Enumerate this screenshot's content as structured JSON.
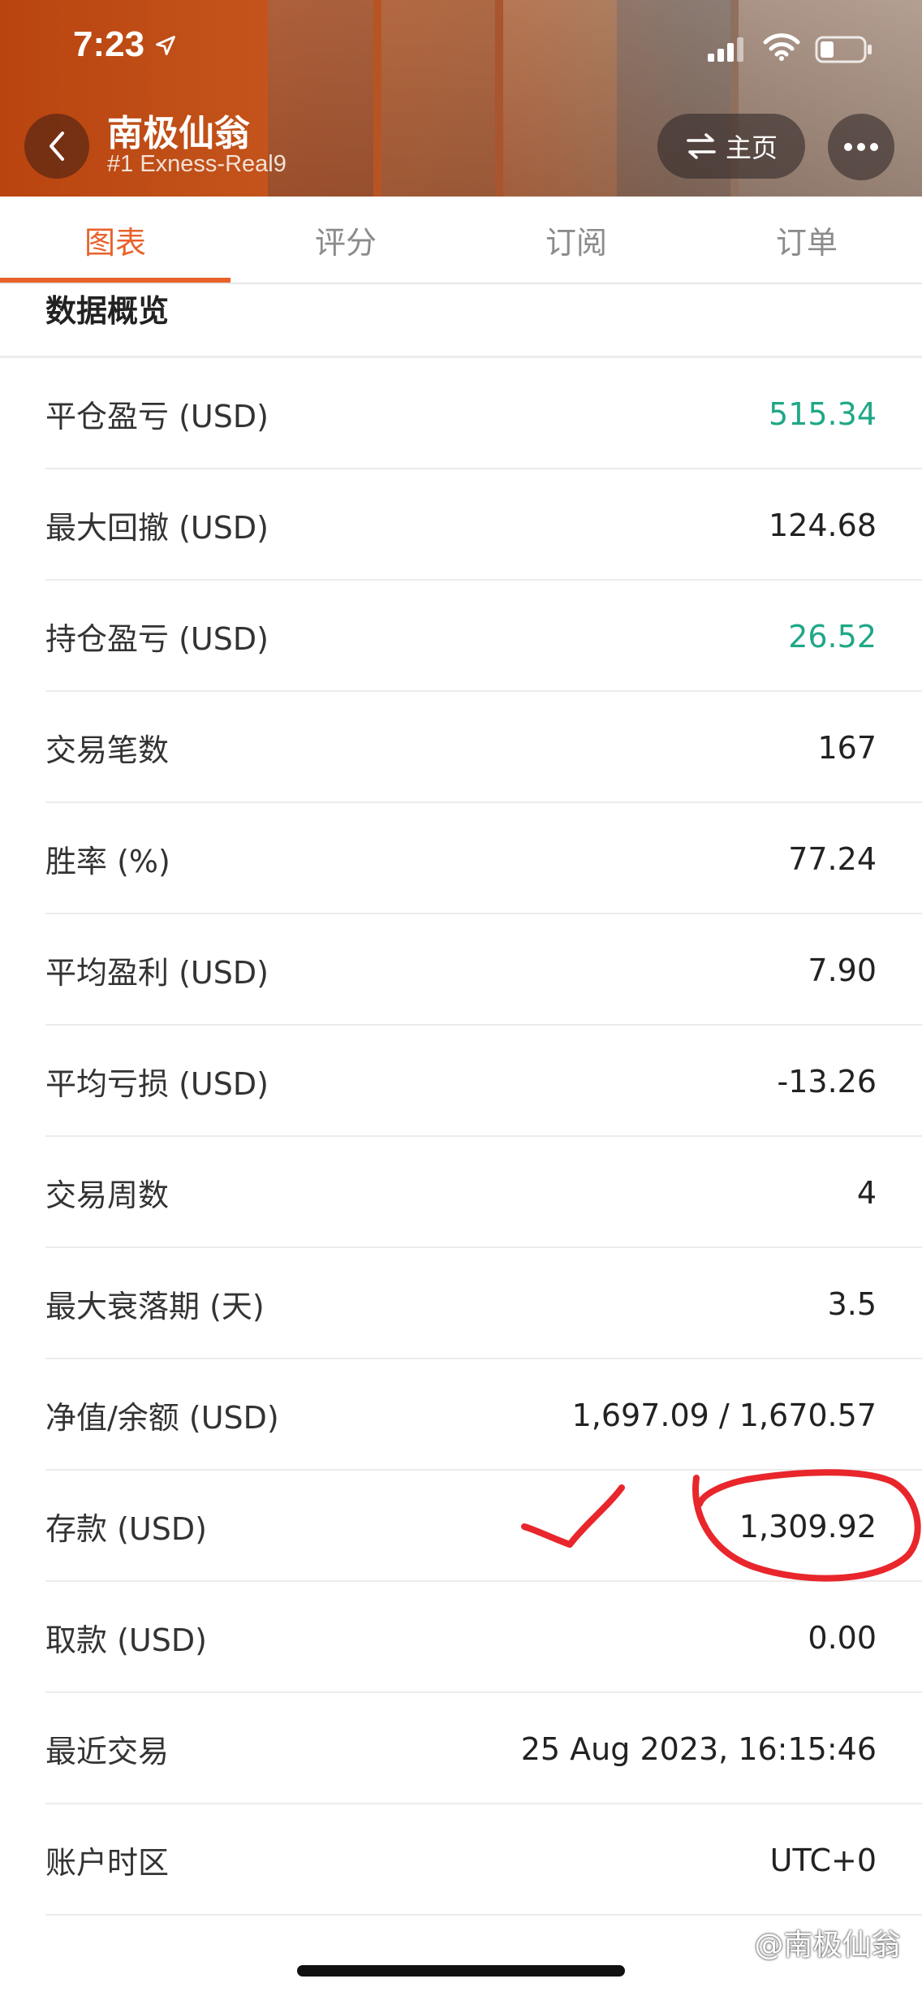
{
  "status_bar": {
    "time": "7:23"
  },
  "header": {
    "title": "南极仙翁",
    "subtitle": "#1 Exness-Real9",
    "home_button_label": "主页",
    "back_icon": "chevron-left-icon",
    "more_icon": "more-horizontal-icon",
    "swap_icon": "swap-arrows-icon"
  },
  "tabs": [
    {
      "label": "图表",
      "active": true
    },
    {
      "label": "评分",
      "active": false
    },
    {
      "label": "订阅",
      "active": false
    },
    {
      "label": "订单",
      "active": false
    }
  ],
  "section": {
    "title": "数据概览",
    "rows": [
      {
        "label": "平仓盈亏 (USD)",
        "value": "515.34",
        "color": "#1fa786"
      },
      {
        "label": "最大回撤 (USD)",
        "value": "124.68",
        "color": "#222222"
      },
      {
        "label": "持仓盈亏 (USD)",
        "value": "26.52",
        "color": "#1fa786"
      },
      {
        "label": "交易笔数",
        "value": "167",
        "color": "#222222"
      },
      {
        "label": "胜率 (%)",
        "value": "77.24",
        "color": "#222222"
      },
      {
        "label": "平均盈利 (USD)",
        "value": "7.90",
        "color": "#222222"
      },
      {
        "label": "平均亏损 (USD)",
        "value": "-13.26",
        "color": "#222222"
      },
      {
        "label": "交易周数",
        "value": "4",
        "color": "#222222"
      },
      {
        "label": "最大衰落期 (天)",
        "value": "3.5",
        "color": "#222222"
      },
      {
        "label": "净值/余额 (USD)",
        "value": "1,697.09 / 1,670.57",
        "color": "#222222"
      },
      {
        "label": "存款 (USD)",
        "value": "1,309.92",
        "color": "#222222"
      },
      {
        "label": "取款 (USD)",
        "value": "0.00",
        "color": "#222222"
      },
      {
        "label": "最近交易",
        "value": "25 Aug 2023, 16:15:46",
        "color": "#222222"
      },
      {
        "label": "账户时区",
        "value": "UTC+0",
        "color": "#222222"
      }
    ]
  },
  "accent_color": "#e8622a",
  "watermark": "@南极仙翁",
  "watermark_icon": "weibo-logo-icon"
}
